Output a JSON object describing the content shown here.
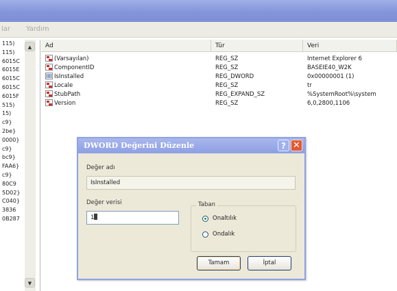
{
  "menu": [
    "lar",
    "Yardım"
  ],
  "tree": {
    "items": [
      "115)",
      "115)",
      "6015C",
      "6015E",
      "6015C",
      "6015C",
      "6015F",
      "515)",
      "15)",
      "c9}",
      "2be}",
      "0000}",
      "c9}",
      "bc9}",
      "FAA6}",
      "c9}",
      "80C9",
      "5D02}",
      "C040}",
      "3836",
      "0B287"
    ]
  },
  "columns": {
    "name": "Ad",
    "type": "Tür",
    "data": "Veri"
  },
  "values": [
    {
      "name": "(Varsayılan)",
      "type": "REG_SZ",
      "data": "Internet Explorer 6",
      "icon": "string-value-icon"
    },
    {
      "name": "ComponentID",
      "type": "REG_SZ",
      "data": "BASEIE40_W2K",
      "icon": "string-value-icon"
    },
    {
      "name": "IsInstalled",
      "type": "REG_DWORD",
      "data": "0x00000001 (1)",
      "icon": "binary-value-icon"
    },
    {
      "name": "Locale",
      "type": "REG_SZ",
      "data": "tr",
      "icon": "string-value-icon"
    },
    {
      "name": "StubPath",
      "type": "REG_EXPAND_SZ",
      "data": "%SystemRoot%\\system",
      "icon": "string-value-icon"
    },
    {
      "name": "Version",
      "type": "REG_SZ",
      "data": "6,0,2800,1106",
      "icon": "string-value-icon"
    }
  ],
  "dialog": {
    "title": "DWORD Değerini Düzenle",
    "value_name_label": "Değer adı",
    "value_name": "IsInstalled",
    "value_data_label": "Değer verisi",
    "value_data": "1",
    "base_label": "Taban",
    "hex_label": "Onaltılık",
    "dec_label": "Ondalık",
    "selected_base": "hex",
    "ok_label": "Tamam",
    "cancel_label": "İptal",
    "help_glyph": "?",
    "close_glyph": "✕"
  },
  "colors": {
    "titlebar": "#8595da",
    "dialog_bg": "#ece9d8",
    "close": "#e25a32"
  }
}
